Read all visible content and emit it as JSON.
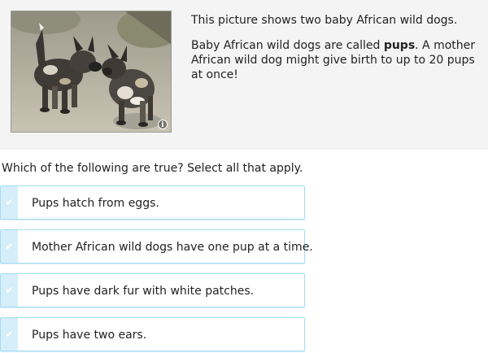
{
  "passage": {
    "line1": "This picture shows two baby African wild dogs.",
    "line2_before": "Baby African wild dogs are called ",
    "line2_bold": "pups",
    "line2_after": ". A mother African wild dog might give birth to up to 20 pups at once!"
  },
  "photo": {
    "info_icon": "i"
  },
  "question": {
    "prompt": "Which of the following are true? Select all that apply."
  },
  "choices": [
    {
      "label": "Pups hatch from eggs.",
      "checkmark": "✔"
    },
    {
      "label": "Mother African wild dogs have one pup at a time.",
      "checkmark": "✔"
    },
    {
      "label": "Pups have dark fur with white patches.",
      "checkmark": "✔"
    },
    {
      "label": "Pups have two ears.",
      "checkmark": "✔"
    }
  ],
  "colors": {
    "choice_border": "#a3dcf2",
    "choice_tab": "#d5eefa",
    "panel_background": "#f4f4f4"
  }
}
